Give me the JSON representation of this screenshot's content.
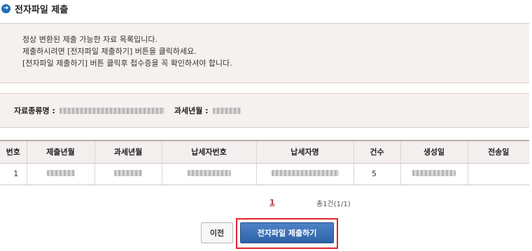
{
  "page": {
    "title": "전자파일 제출",
    "title_icon": "arrow-right-circle-icon"
  },
  "info": {
    "lines": [
      "정상 변환된 제출 가능한 자료 목록입니다.",
      "제출하시려면 [전자파일 제출하기] 버튼을 클릭하세요.",
      "[전자파일 제출하기] 버튼 클릭후 접수증을 꼭 확인하셔야 합니다."
    ]
  },
  "filter": {
    "doc_type_label": "자료종류명 :",
    "tax_year_label": "과세년월 :"
  },
  "table": {
    "headers": [
      "번호",
      "제출년월",
      "과세년월",
      "납세자번호",
      "납세자명",
      "건수",
      "생성일",
      "전송일"
    ],
    "rows": [
      {
        "no": "1",
        "count": "5",
        "sent_date": ""
      }
    ]
  },
  "pager": {
    "current_page": "1",
    "summary": "총1건(1/1)"
  },
  "buttons": {
    "prev": "이전",
    "submit": "전자파일 제출하기"
  },
  "colors": {
    "accent": "#1f6fb5",
    "highlight_box": "#e0262b",
    "page_link": "#b33a3a"
  }
}
